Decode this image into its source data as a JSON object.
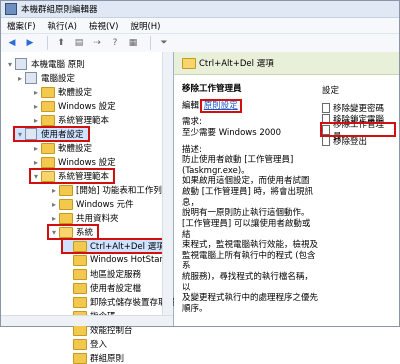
{
  "title": "本機群組原則編輯器",
  "menu": [
    "檔案(F)",
    "執行(A)",
    "檢視(V)",
    "說明(H)"
  ],
  "tree": [
    {
      "label": "本機電腦 原則",
      "level": 0,
      "icon": "computer-icon"
    },
    {
      "label": "電腦設定",
      "level": 1,
      "icon": "computer-icon"
    },
    {
      "label": "軟體設定",
      "level": 2,
      "icon": "folder-icon"
    },
    {
      "label": "Windows 設定",
      "level": 2,
      "icon": "folder-icon"
    },
    {
      "label": "系統管理範本",
      "level": 2,
      "icon": "folder-icon"
    },
    {
      "label": "使用者設定",
      "level": 1,
      "icon": "user-icon"
    },
    {
      "label": "軟體設定",
      "level": 2,
      "icon": "folder-icon"
    },
    {
      "label": "Windows 設定",
      "level": 2,
      "icon": "folder-icon"
    },
    {
      "label": "系統管理範本",
      "level": 2,
      "icon": "folder-icon"
    },
    {
      "label": "[開始] 功能表和工作列",
      "level": 3,
      "icon": "folder-icon"
    },
    {
      "label": "Windows 元件",
      "level": 3,
      "icon": "folder-icon"
    },
    {
      "label": "共用資料夾",
      "level": 3,
      "icon": "folder-icon"
    },
    {
      "label": "系統",
      "level": 3,
      "icon": "folder-icon"
    },
    {
      "label": "Ctrl+Alt+Del 選項",
      "level": 4,
      "icon": "folder-icon"
    },
    {
      "label": "Windows HotStart",
      "level": 4,
      "icon": "folder-icon"
    },
    {
      "label": "地區設定服務",
      "level": 4,
      "icon": "folder-icon"
    },
    {
      "label": "使用者設定檔",
      "level": 4,
      "icon": "folder-icon"
    },
    {
      "label": "卸除式儲存裝置存取權",
      "level": 4,
      "icon": "folder-icon"
    },
    {
      "label": "指令碼",
      "level": 4,
      "icon": "folder-icon"
    },
    {
      "label": "效能控制台",
      "level": 4,
      "icon": "folder-icon"
    },
    {
      "label": "登入",
      "level": 4,
      "icon": "folder-icon"
    },
    {
      "label": "群組原則",
      "level": 4,
      "icon": "folder-icon"
    }
  ],
  "right_header": "Ctrl+Alt+Del 選項",
  "detail": {
    "title": "移除工作管理員",
    "edit_label": "編輯",
    "edit_link": "原則設定",
    "req_label": "需求:",
    "req_value": "至少需要 Windows 2000",
    "desc_label": "描述:",
    "desc_lines": [
      "防止使用者啟動 [工作管理員]",
      "(Taskmgr.exe)。",
      "",
      "如果啟用這個設定，而使用者試圖",
      "啟動 [工作管理員] 時，將會出現訊息，",
      "說明有一原則防止執行這個動作。",
      "",
      "[工作管理員] 可以讓使用者啟動或結",
      "束程式，監視電腦執行效能，檢視及",
      "監視電腦上所有執行中的程式 (包含系",
      "統服務)，尋找程式的執行檔名稱，以",
      "及變更程式執行中的處理程序之優先",
      "順序。"
    ]
  },
  "settings": {
    "title": "設定",
    "items": [
      "移除變更密碼",
      "移除鎖定電腦",
      "移除工作管理員",
      "移除登出"
    ]
  }
}
